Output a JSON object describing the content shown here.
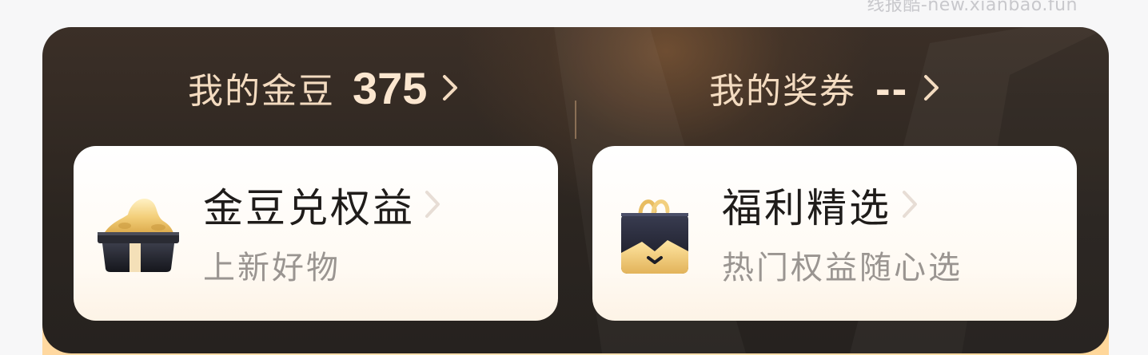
{
  "watermark": "线报酷-new.xianbao.fun",
  "stats": {
    "beans_label": "我的金豆",
    "beans_value": "375",
    "coupons_label": "我的奖券",
    "coupons_value": "--"
  },
  "cards": [
    {
      "title": "金豆兑权益",
      "subtitle": "上新好物",
      "icon": "gold-bean-box-icon"
    },
    {
      "title": "福利精选",
      "subtitle": "热门权益随心选",
      "icon": "shopping-bag-icon"
    }
  ],
  "colors": {
    "panel_bg": "#2b2520",
    "stat_text": "#f3dbc0",
    "card_title": "#1f1c1a",
    "card_subtitle": "#9a9591",
    "bottom_strip": "#ffd8a0"
  }
}
